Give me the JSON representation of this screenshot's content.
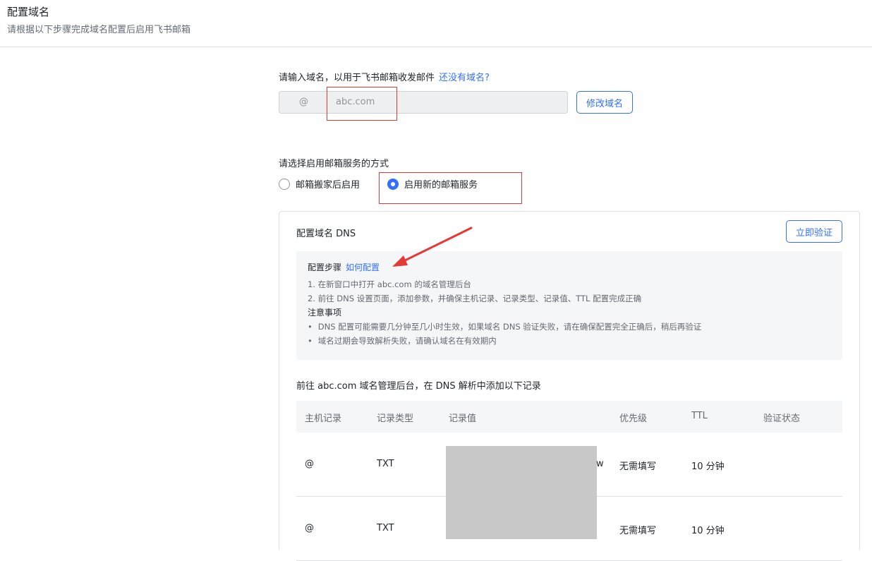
{
  "header": {
    "title": "配置域名",
    "subtitle": "请根据以下步骤完成域名配置后启用飞书邮箱"
  },
  "domain": {
    "label": "请输入域名，以用于飞书邮箱收发邮件",
    "no_domain_link": "还没有域名?",
    "at_symbol": "@",
    "value": "abc.com",
    "edit_button": "修改域名"
  },
  "service": {
    "label": "请选择启用邮箱服务的方式",
    "options": [
      {
        "label": "邮箱搬家后启用",
        "checked": false
      },
      {
        "label": "启用新的邮箱服务",
        "checked": true
      }
    ]
  },
  "dns_panel": {
    "title": "配置域名 DNS",
    "verify_button": "立即验证",
    "steps_title": "配置步骤",
    "how_link": "如何配置",
    "steps": [
      "1. 在新窗口中打开 abc.com 的域名管理后台",
      "2. 前往 DNS 设置页面，添加参数，并确保主机记录、记录类型、记录值、TTL 配置完成正确"
    ],
    "notes_title": "注意事项",
    "notes": [
      "DNS 配置可能需要几分钟至几小时生效，如果域名 DNS 验证失败，请在确保配置完全正确后，稍后再验证",
      "域名过期会导致解析失败，请确认域名在有效期内"
    ],
    "records_intro": "前往 abc.com 域名管理后台，在 DNS 解析中添加以下记录"
  },
  "table": {
    "headers": [
      "主机记录",
      "记录类型",
      "记录值",
      "优先级",
      "TTL",
      "验证状态"
    ],
    "rows": [
      {
        "host": "@",
        "type": "TXT",
        "value": "",
        "priority": "无需填写",
        "ttl": "10 分钟",
        "status": ""
      },
      {
        "host": "@",
        "type": "TXT",
        "value": "",
        "priority": "无需填写",
        "ttl": "10 分钟",
        "status": ""
      }
    ],
    "stray_char": "w"
  },
  "colors": {
    "accent": "#3370ff",
    "annotation": "#e53935",
    "redaction": "#c8c8c8"
  }
}
